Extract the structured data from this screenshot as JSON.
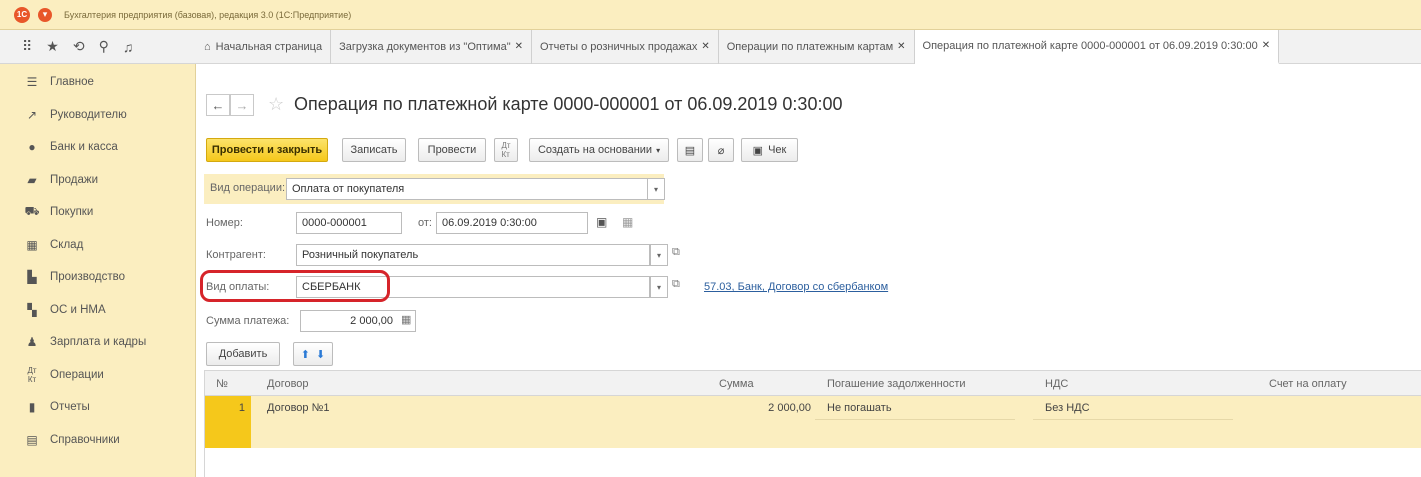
{
  "window": {
    "title": "Бухгалтерия предприятия (базовая), редакция 3.0 (1С:Предприятие)"
  },
  "tabs": [
    {
      "label": "Начальная страница",
      "closable": false
    },
    {
      "label": "Загрузка документов из \"Оптима\"",
      "closable": true
    },
    {
      "label": "Отчеты о розничных продажах",
      "closable": true
    },
    {
      "label": "Операции по платежным картам",
      "closable": true
    },
    {
      "label": "Операция по платежной карте 0000-000001 от 06.09.2019 0:30:00",
      "closable": true,
      "active": true
    }
  ],
  "sidebar": {
    "items": [
      {
        "label": "Главное",
        "icon": "menu-lines-icon"
      },
      {
        "label": "Руководителю",
        "icon": "trend-icon"
      },
      {
        "label": "Банк и касса",
        "icon": "coins-icon"
      },
      {
        "label": "Продажи",
        "icon": "bag-icon"
      },
      {
        "label": "Покупки",
        "icon": "cart-icon"
      },
      {
        "label": "Склад",
        "icon": "warehouse-icon"
      },
      {
        "label": "Производство",
        "icon": "factory-icon"
      },
      {
        "label": "ОС и НМА",
        "icon": "assets-icon"
      },
      {
        "label": "Зарплата и кадры",
        "icon": "person-icon"
      },
      {
        "label": "Операции",
        "icon": "debit-credit-icon"
      },
      {
        "label": "Отчеты",
        "icon": "bar-chart-icon"
      },
      {
        "label": "Справочники",
        "icon": "book-icon"
      }
    ]
  },
  "document": {
    "title": "Операция по платежной карте 0000-000001 от 06.09.2019 0:30:00"
  },
  "toolbar": {
    "post_close": "Провести и закрыть",
    "save": "Записать",
    "post": "Провести",
    "create_based": "Создать на основании",
    "receipt": "Чек"
  },
  "form": {
    "op_type_label": "Вид операции:",
    "op_type_value": "Оплата от покупателя",
    "number_label": "Номер:",
    "number_value": "0000-000001",
    "date_label": "от:",
    "date_value": "06.09.2019  0:30:00",
    "contractor_label": "Контрагент:",
    "contractor_value": "Розничный покупатель",
    "payment_type_label": "Вид оплаты:",
    "payment_type_value": "СБЕРБАНК",
    "payment_type_link": "57.03, Банк, Договор со сбербанком",
    "amount_label": "Сумма платежа:",
    "amount_value": "2 000,00",
    "add_button": "Добавить"
  },
  "table": {
    "columns": [
      "№",
      "Договор",
      "Сумма",
      "Погашение задолженности",
      "НДС",
      "Счет на оплату"
    ],
    "rows": [
      {
        "n": "1",
        "contract": "Договор №1",
        "amount": "2 000,00",
        "repayment": "Не погашать",
        "vat": "Без НДС",
        "invoice": ""
      }
    ]
  },
  "colors": {
    "accent_yellow": "#f5c81b",
    "sidebar_bg": "#fbeec0",
    "highlight_red": "#d6242a",
    "link_blue": "#2c5f9e"
  }
}
